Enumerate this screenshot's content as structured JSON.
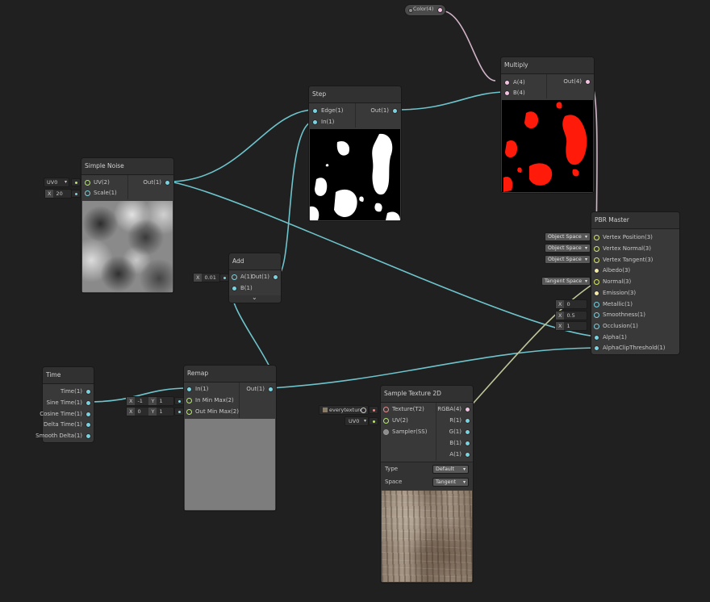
{
  "colors": {
    "canvas": "#202020",
    "node": "#393939",
    "edge_vector1": "#6ec4cc",
    "edge_vector4": "#d2b4c8",
    "edge_texture": "#bfc79a",
    "red_mask": "#ff1a0a"
  },
  "color_node": {
    "label": "Color(4)"
  },
  "multiply": {
    "title": "Multiply",
    "inputs": [
      "A(4)",
      "B(4)"
    ],
    "output": "Out(4)"
  },
  "step": {
    "title": "Step",
    "inputs": [
      "Edge(1)",
      "In(1)"
    ],
    "output": "Out(1)"
  },
  "simple_noise": {
    "title": "Simple Noise",
    "inputs": [
      "UV(2)",
      "Scale(1)"
    ],
    "output": "Out(1)",
    "uv_value": "UV0",
    "scale_axis": "X",
    "scale_value": "20"
  },
  "add": {
    "title": "Add",
    "inputs": [
      "A(1)",
      "B(1)"
    ],
    "output": "Out(1)",
    "a_axis": "X",
    "a_value": "0.01",
    "expand_icon": "chevron-down-icon"
  },
  "pbr_master": {
    "title": "PBR Master",
    "inputs": [
      "Vertex Position(3)",
      "Vertex Normal(3)",
      "Vertex Tangent(3)",
      "Albedo(3)",
      "Normal(3)",
      "Emission(3)",
      "Metallic(1)",
      "Smoothness(1)",
      "Occlusion(1)",
      "Alpha(1)",
      "AlphaClipThreshold(1)"
    ],
    "space_vertex_position": "Object Space",
    "space_vertex_normal": "Object Space",
    "space_vertex_tangent": "Object Space",
    "space_normal": "Tangent Space",
    "metallic_axis": "X",
    "metallic_value": "0",
    "smoothness_axis": "X",
    "smoothness_value": "0.5",
    "occlusion_axis": "X",
    "occlusion_value": "1"
  },
  "time": {
    "title": "Time",
    "outputs": [
      "Time(1)",
      "Sine Time(1)",
      "Cosine Time(1)",
      "Delta Time(1)",
      "Smooth Delta(1)"
    ]
  },
  "remap": {
    "title": "Remap",
    "inputs": [
      "In(1)",
      "In Min Max(2)",
      "Out Min Max(2)"
    ],
    "output": "Out(1)",
    "in_min_max": {
      "x_axis": "X",
      "x": "-1",
      "y_axis": "Y",
      "y": "1"
    },
    "out_min_max": {
      "x_axis": "X",
      "x": "0",
      "y_axis": "Y",
      "y": "1"
    }
  },
  "sample_texture": {
    "title": "Sample Texture 2D",
    "inputs": [
      "Texture(T2)",
      "UV(2)",
      "Sampler(SS)"
    ],
    "outputs": [
      "RGBA(4)",
      "R(1)",
      "G(1)",
      "B(1)",
      "A(1)"
    ],
    "texture_field": "everytexture",
    "uv_value": "UV0",
    "type_label": "Type",
    "type_value": "Default",
    "space_label": "Space",
    "space_value": "Tangent"
  }
}
